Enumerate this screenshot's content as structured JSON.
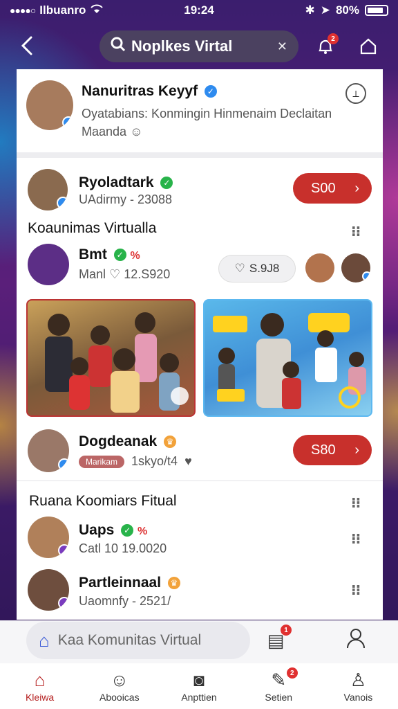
{
  "status": {
    "carrier": "Ilbuanro",
    "time": "19:24",
    "battery": "80%"
  },
  "header": {
    "search_text": "Noplkes Virtal",
    "notification_badge": "2"
  },
  "top_card": {
    "name": "Nanuritras Keyyf",
    "subtitle_line1": "Oyatabians: Konmingin Hinmenaim Declaitan",
    "subtitle_line2": "Maanda"
  },
  "user1": {
    "name": "Ryoladtark",
    "sub": "UAdirmy - 23088",
    "price": "S00"
  },
  "section1": {
    "title": "Koaunimas Virtualla"
  },
  "post": {
    "name": "Bmt",
    "sub": "Manl",
    "count": "12.S920",
    "like_count": "S.9J8"
  },
  "user2": {
    "name": "Dogdeanak",
    "tag": "Marikam",
    "sub": "1skyo/t4",
    "price": "S80"
  },
  "section2": {
    "title": "Ruana Koomiars Fitual"
  },
  "list": [
    {
      "name": "Uaps",
      "sub": "Catl 10",
      "time": "19.0020"
    },
    {
      "name": "Partleinnaal",
      "sub": "Uaomnfy - 2521/"
    }
  ],
  "bottom_search": {
    "placeholder": "Kaa Komunitas Virtual",
    "notif_badge": "1"
  },
  "tabs": [
    {
      "label": "Kleiwa"
    },
    {
      "label": "Abooicas"
    },
    {
      "label": "Anpttien"
    },
    {
      "label": "Setien"
    },
    {
      "label": "Vanois"
    }
  ],
  "tab_badge": "2"
}
